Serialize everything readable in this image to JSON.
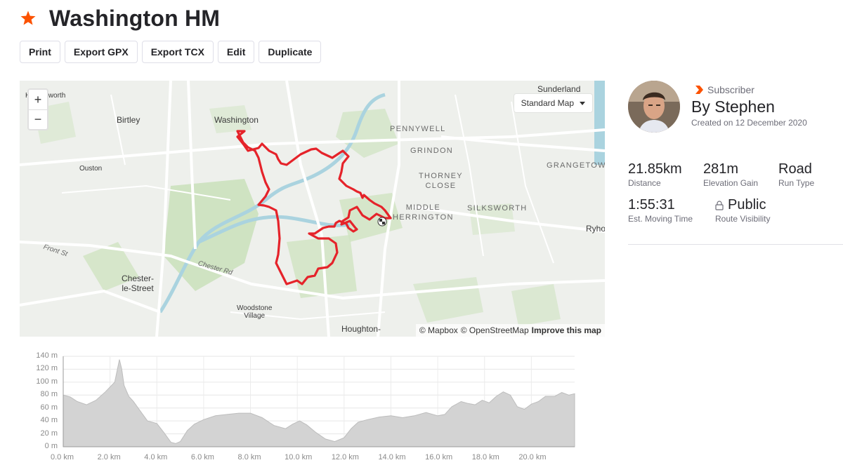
{
  "route": {
    "title": "Washington HM",
    "star_color": "#fc5200"
  },
  "toolbar": {
    "print": "Print",
    "export_gpx": "Export GPX",
    "export_tcx": "Export TCX",
    "edit": "Edit",
    "duplicate": "Duplicate"
  },
  "map": {
    "zoom_in": "+",
    "zoom_out": "−",
    "style_select": "Standard Map",
    "attribution_mapbox": "© Mapbox",
    "attribution_osm": "© OpenStreetMap",
    "attribution_improve": "Improve this map",
    "route_color": "#e5232a",
    "labels": {
      "kibblesworth": "Kibblesworth",
      "birtley": "Birtley",
      "washington": "Washington",
      "ouston": "Ouston",
      "front_st": "Front St",
      "chester_street": "Chester-\nle-Street",
      "chester_rd": "Chester Rd",
      "woodstone": "Woodstone\nVillage",
      "houghton": "Houghton-",
      "sunderland": "Sunderland",
      "pennywell": "PENNYWELL",
      "grindon": "GRINDON",
      "thorney_close": "THORNEY\nCLOSE",
      "grangetown": "GRANGETOWN",
      "middle_herrington": "MIDDLE\nHERRINGTON",
      "silksworth": "SILKSWORTH",
      "ryhope": "Ryhope"
    }
  },
  "elevation": {
    "y_ticks": [
      "140 m",
      "120 m",
      "100 m",
      "80 m",
      "60 m",
      "40 m",
      "20 m",
      "0 m"
    ],
    "x_ticks": [
      "0.0 km",
      "2.0 km",
      "4.0 km",
      "6.0 km",
      "8.0 km",
      "10.0 km",
      "12.0 km",
      "14.0 km",
      "16.0 km",
      "18.0 km",
      "20.0 km"
    ]
  },
  "chart_data": {
    "type": "area",
    "title": "",
    "xlabel": "",
    "ylabel": "",
    "x_unit": "km",
    "y_unit": "m",
    "xlim": [
      0,
      21.85
    ],
    "ylim": [
      0,
      140
    ],
    "grid": true,
    "series": [
      {
        "x": [
          0.0,
          0.3,
          0.6,
          1.0,
          1.4,
          1.8,
          2.2,
          2.4,
          2.5,
          2.6,
          2.8,
          3.0,
          3.3,
          3.6,
          4.0,
          4.3,
          4.6,
          4.8,
          5.0,
          5.3,
          5.6,
          6.0,
          6.5,
          7.0,
          7.5,
          8.0,
          8.5,
          9.0,
          9.5,
          9.8,
          10.1,
          10.4,
          10.8,
          11.2,
          11.6,
          12.0,
          12.3,
          12.6,
          13.0,
          13.5,
          14.0,
          14.5,
          15.0,
          15.5,
          16.0,
          16.3,
          16.6,
          17.0,
          17.3,
          17.6,
          17.9,
          18.2,
          18.5,
          18.8,
          19.1,
          19.4,
          19.7,
          20.0,
          20.3,
          20.6,
          21.0,
          21.3,
          21.6,
          21.85
        ],
        "y": [
          80,
          77,
          70,
          65,
          72,
          85,
          100,
          135,
          120,
          95,
          78,
          70,
          55,
          40,
          36,
          22,
          7,
          5,
          8,
          25,
          35,
          42,
          48,
          50,
          52,
          52,
          45,
          33,
          28,
          35,
          40,
          34,
          22,
          12,
          8,
          14,
          28,
          38,
          42,
          46,
          48,
          45,
          48,
          53,
          48,
          50,
          62,
          70,
          67,
          65,
          72,
          68,
          78,
          85,
          80,
          62,
          58,
          66,
          70,
          78,
          78,
          84,
          80,
          82
        ]
      }
    ]
  },
  "sidebar": {
    "subscriber_label": "Subscriber",
    "subscriber_color": "#fc5200",
    "author": "By Stephen",
    "created": "Created on 12 December 2020",
    "stats": {
      "distance": {
        "value": "21.85km",
        "label": "Distance"
      },
      "elevation": {
        "value": "281m",
        "label": "Elevation Gain"
      },
      "run_type": {
        "value": "Road",
        "label": "Run Type"
      },
      "moving_time": {
        "value": "1:55:31",
        "label": "Est. Moving Time"
      },
      "visibility": {
        "value": "Public",
        "label": "Route Visibility"
      }
    }
  }
}
